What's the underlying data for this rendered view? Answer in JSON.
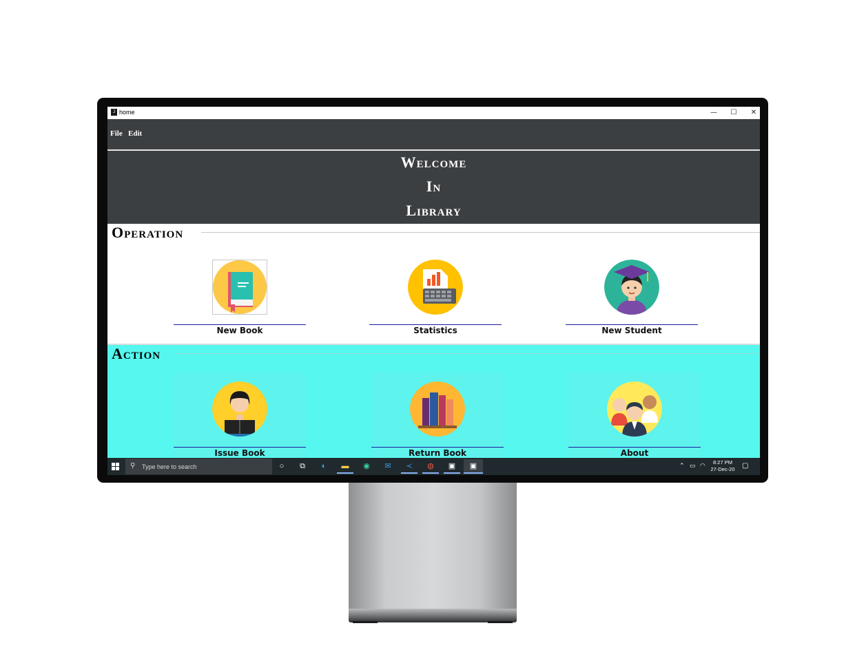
{
  "window": {
    "title": "home",
    "minimize_glyph": "—",
    "maximize_glyph": "☐",
    "close_glyph": "✕"
  },
  "menu": {
    "items": [
      {
        "label": "File"
      },
      {
        "label": "Edit"
      }
    ]
  },
  "welcome": {
    "lines": [
      "Welcome",
      "In",
      "Library"
    ]
  },
  "sections": {
    "operation": {
      "title": "Operation",
      "tiles": [
        {
          "label": "New Book",
          "icon": "book-icon"
        },
        {
          "label": "Statistics",
          "icon": "statistics-icon"
        },
        {
          "label": "New Student",
          "icon": "student-icon"
        }
      ]
    },
    "action": {
      "title": "Action",
      "tiles": [
        {
          "label": "Issue Book",
          "icon": "reader-icon"
        },
        {
          "label": "Return Book",
          "icon": "books-icon"
        },
        {
          "label": "About",
          "icon": "team-icon"
        }
      ]
    }
  },
  "taskbar": {
    "search_placeholder": "Type here to search",
    "time": "8:27 PM",
    "date": "27-Dec-20",
    "apps": [
      "cortana",
      "task-view",
      "edge",
      "file-explorer",
      "git-kraken",
      "mail",
      "vs-code",
      "chrome",
      "intellij",
      "jetbrains-jb"
    ]
  },
  "colors": {
    "header_bg": "#3c3f41",
    "action_bg": "#55f7ee",
    "label_underline": "#1a1aa0",
    "taskbar_bg": "#202a2e"
  }
}
